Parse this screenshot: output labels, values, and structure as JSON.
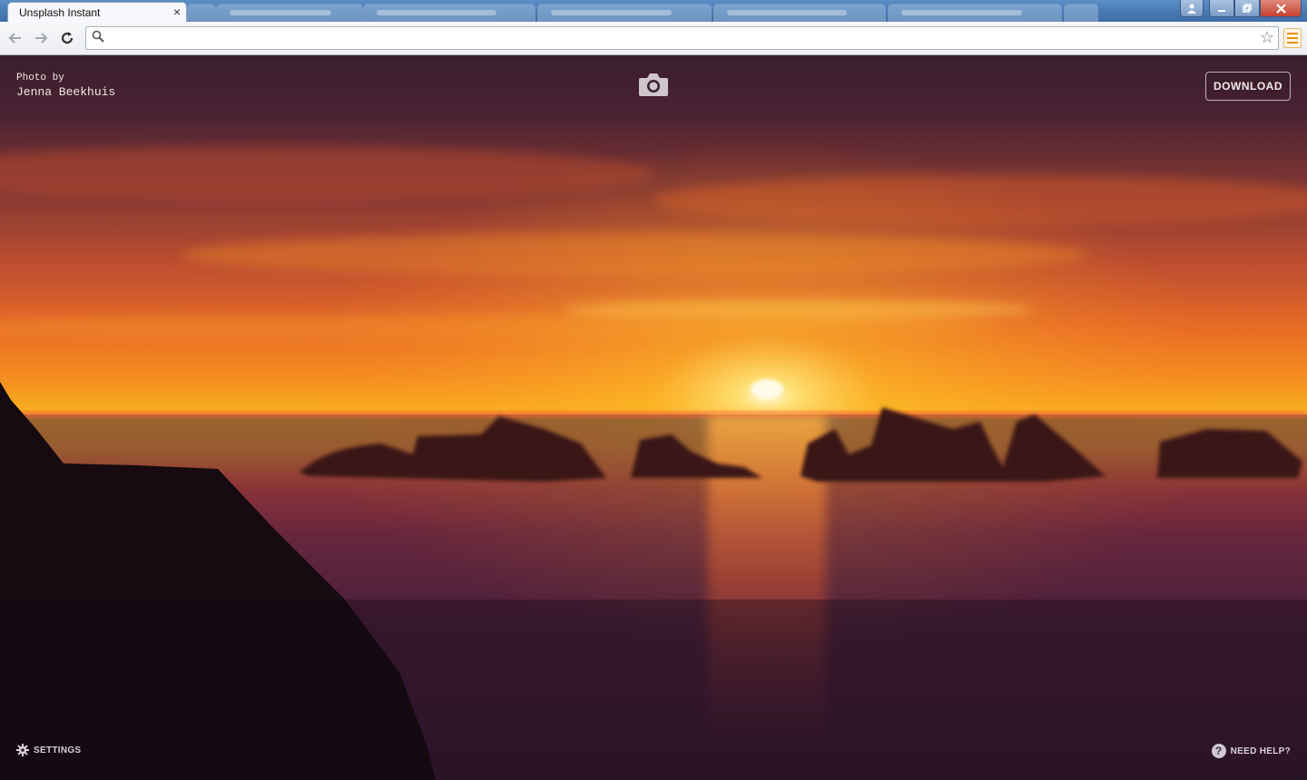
{
  "browser": {
    "active_tab_title": "Unsplash Instant",
    "close_glyph": "×",
    "omnibox_value": "",
    "colors": {
      "menu_accent": "#e8900c"
    }
  },
  "page": {
    "credit_prefix": "Photo by",
    "credit_author": "Jenna Beekhuis",
    "download_label": "DOWNLOAD",
    "settings_label": "SETTINGS",
    "help_label": "NEED HELP?",
    "help_glyph": "?",
    "icons": {
      "camera": "camera-icon",
      "settings": "gear-icon",
      "help": "question-icon"
    }
  }
}
